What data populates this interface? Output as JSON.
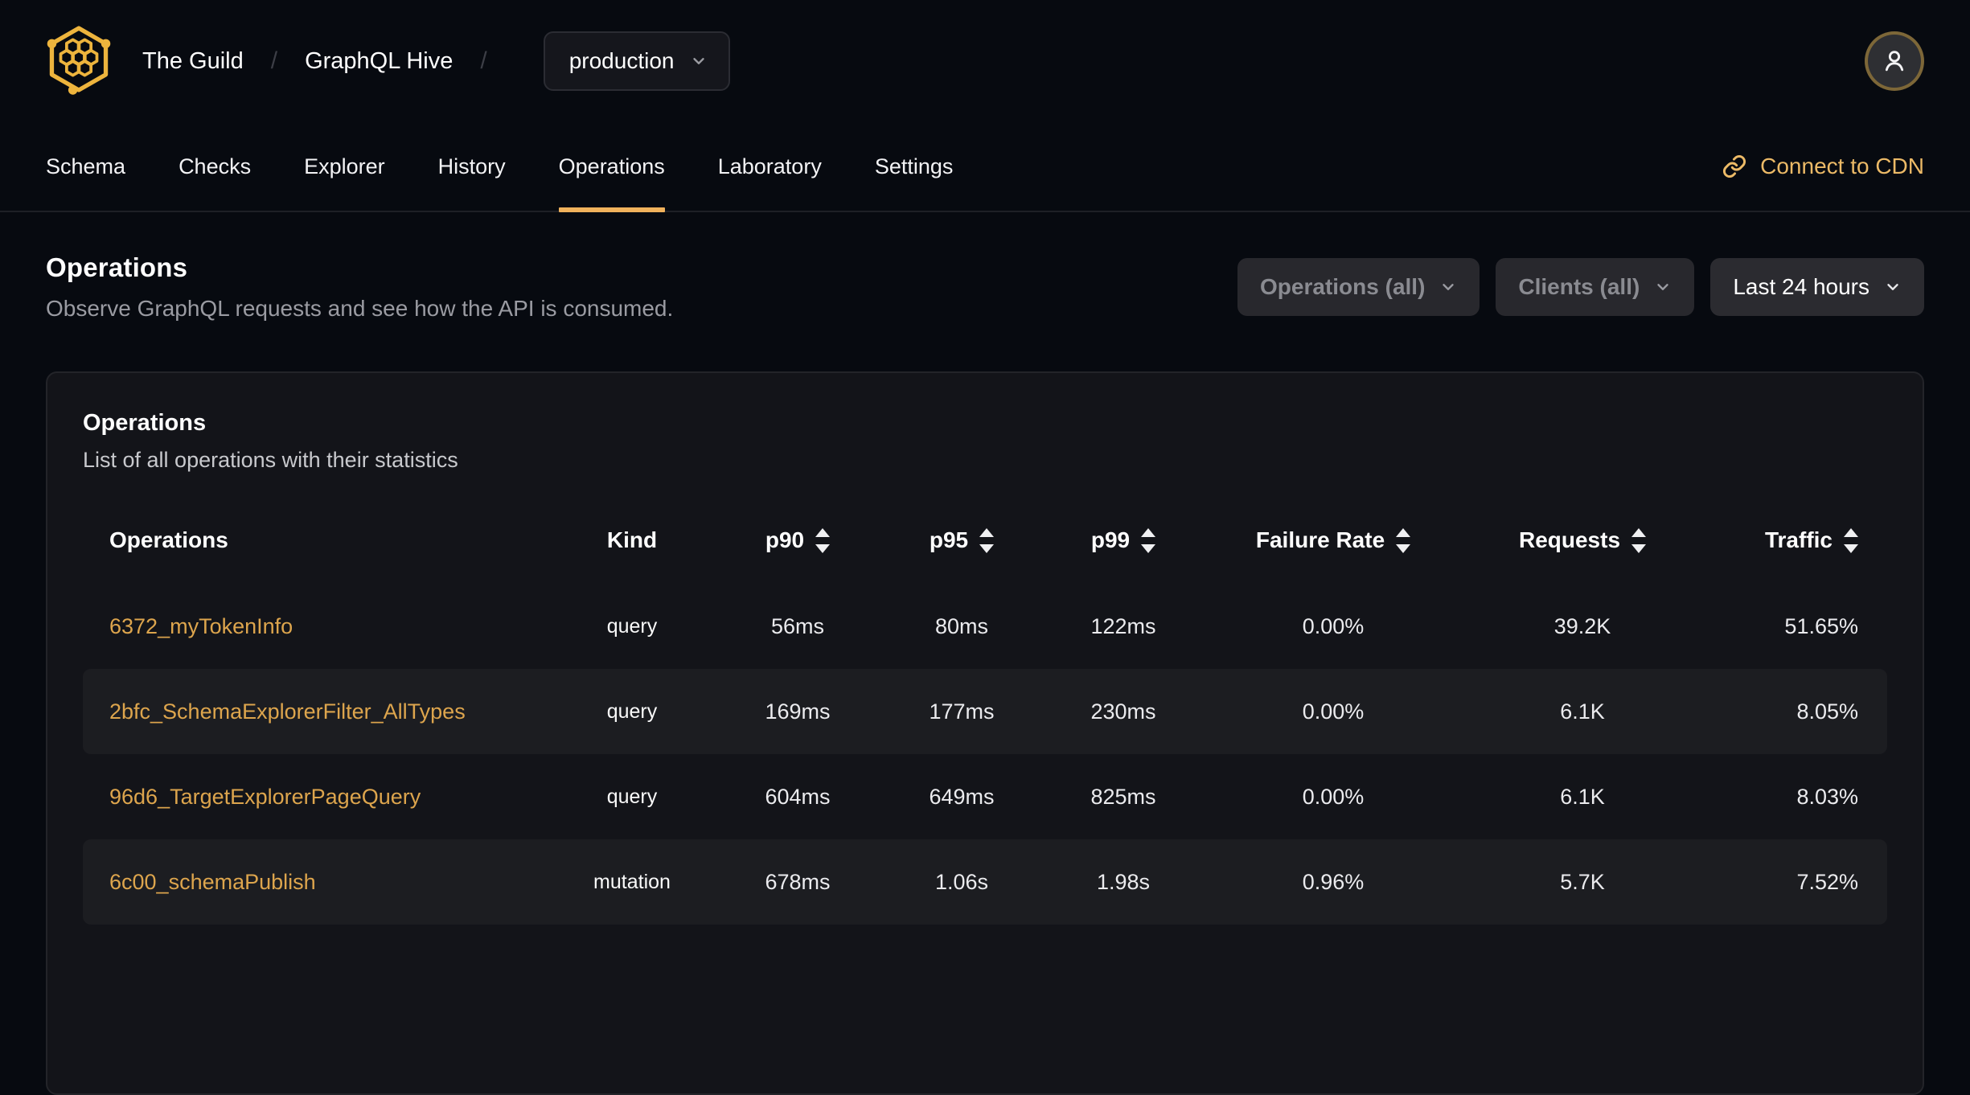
{
  "header": {
    "org": "The Guild",
    "project": "GraphQL Hive",
    "separator": "/",
    "target_selector": {
      "value": "production"
    }
  },
  "nav": {
    "tabs": [
      {
        "label": "Schema",
        "active": false
      },
      {
        "label": "Checks",
        "active": false
      },
      {
        "label": "Explorer",
        "active": false
      },
      {
        "label": "History",
        "active": false
      },
      {
        "label": "Operations",
        "active": true
      },
      {
        "label": "Laboratory",
        "active": false
      },
      {
        "label": "Settings",
        "active": false
      }
    ],
    "cdn_link_label": "Connect to CDN"
  },
  "page": {
    "title": "Operations",
    "subtitle": "Observe GraphQL requests and see how the API is consumed."
  },
  "filters": {
    "operations": "Operations (all)",
    "clients": "Clients (all)",
    "period": "Last 24 hours"
  },
  "card": {
    "title": "Operations",
    "subtitle": "List of all operations with their statistics"
  },
  "table": {
    "columns": [
      {
        "label": "Operations",
        "sortable": false
      },
      {
        "label": "Kind",
        "sortable": false
      },
      {
        "label": "p90",
        "sortable": true
      },
      {
        "label": "p95",
        "sortable": true
      },
      {
        "label": "p99",
        "sortable": true
      },
      {
        "label": "Failure Rate",
        "sortable": true
      },
      {
        "label": "Requests",
        "sortable": true
      },
      {
        "label": "Traffic",
        "sortable": true
      }
    ],
    "rows": [
      {
        "name": "6372_myTokenInfo",
        "kind": "query",
        "p90": "56ms",
        "p95": "80ms",
        "p99": "122ms",
        "failure_rate": "0.00%",
        "requests": "39.2K",
        "traffic": "51.65%"
      },
      {
        "name": "2bfc_SchemaExplorerFilter_AllTypes",
        "kind": "query",
        "p90": "169ms",
        "p95": "177ms",
        "p99": "230ms",
        "failure_rate": "0.00%",
        "requests": "6.1K",
        "traffic": "8.05%"
      },
      {
        "name": "96d6_TargetExplorerPageQuery",
        "kind": "query",
        "p90": "604ms",
        "p95": "649ms",
        "p99": "825ms",
        "failure_rate": "0.00%",
        "requests": "6.1K",
        "traffic": "8.03%"
      },
      {
        "name": "6c00_schemaPublish",
        "kind": "mutation",
        "p90": "678ms",
        "p95": "1.06s",
        "p99": "1.98s",
        "failure_rate": "0.96%",
        "requests": "5.7K",
        "traffic": "7.52%"
      }
    ]
  },
  "colors": {
    "accent_gold": "#f0b25c",
    "logo_gold": "#edb43d",
    "link_amber": "#ecba67",
    "operation_link": "#dda54d",
    "page_background": "#070a10",
    "card_background": "#131419",
    "row_stripe": "#1c1d21"
  }
}
